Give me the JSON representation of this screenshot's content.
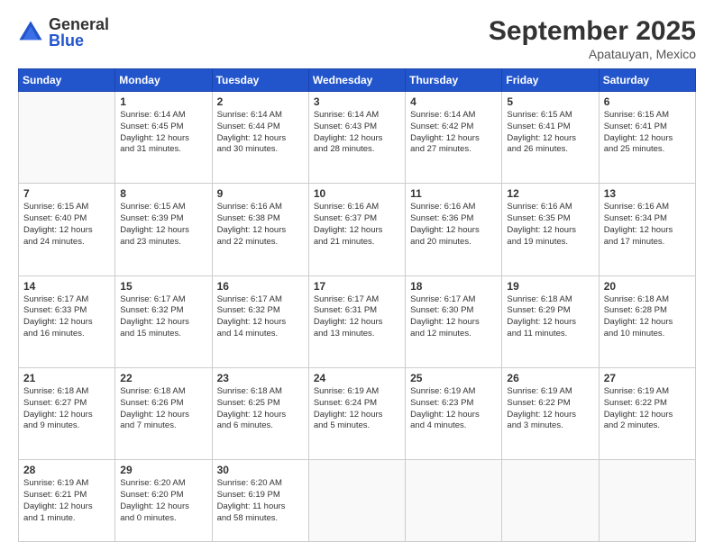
{
  "logo": {
    "general": "General",
    "blue": "Blue"
  },
  "title": "September 2025",
  "location": "Apatauyan, Mexico",
  "days": [
    "Sunday",
    "Monday",
    "Tuesday",
    "Wednesday",
    "Thursday",
    "Friday",
    "Saturday"
  ],
  "weeks": [
    [
      {
        "day": "",
        "info": ""
      },
      {
        "day": "1",
        "info": "Sunrise: 6:14 AM\nSunset: 6:45 PM\nDaylight: 12 hours\nand 31 minutes."
      },
      {
        "day": "2",
        "info": "Sunrise: 6:14 AM\nSunset: 6:44 PM\nDaylight: 12 hours\nand 30 minutes."
      },
      {
        "day": "3",
        "info": "Sunrise: 6:14 AM\nSunset: 6:43 PM\nDaylight: 12 hours\nand 28 minutes."
      },
      {
        "day": "4",
        "info": "Sunrise: 6:14 AM\nSunset: 6:42 PM\nDaylight: 12 hours\nand 27 minutes."
      },
      {
        "day": "5",
        "info": "Sunrise: 6:15 AM\nSunset: 6:41 PM\nDaylight: 12 hours\nand 26 minutes."
      },
      {
        "day": "6",
        "info": "Sunrise: 6:15 AM\nSunset: 6:41 PM\nDaylight: 12 hours\nand 25 minutes."
      }
    ],
    [
      {
        "day": "7",
        "info": "Sunrise: 6:15 AM\nSunset: 6:40 PM\nDaylight: 12 hours\nand 24 minutes."
      },
      {
        "day": "8",
        "info": "Sunrise: 6:15 AM\nSunset: 6:39 PM\nDaylight: 12 hours\nand 23 minutes."
      },
      {
        "day": "9",
        "info": "Sunrise: 6:16 AM\nSunset: 6:38 PM\nDaylight: 12 hours\nand 22 minutes."
      },
      {
        "day": "10",
        "info": "Sunrise: 6:16 AM\nSunset: 6:37 PM\nDaylight: 12 hours\nand 21 minutes."
      },
      {
        "day": "11",
        "info": "Sunrise: 6:16 AM\nSunset: 6:36 PM\nDaylight: 12 hours\nand 20 minutes."
      },
      {
        "day": "12",
        "info": "Sunrise: 6:16 AM\nSunset: 6:35 PM\nDaylight: 12 hours\nand 19 minutes."
      },
      {
        "day": "13",
        "info": "Sunrise: 6:16 AM\nSunset: 6:34 PM\nDaylight: 12 hours\nand 17 minutes."
      }
    ],
    [
      {
        "day": "14",
        "info": "Sunrise: 6:17 AM\nSunset: 6:33 PM\nDaylight: 12 hours\nand 16 minutes."
      },
      {
        "day": "15",
        "info": "Sunrise: 6:17 AM\nSunset: 6:32 PM\nDaylight: 12 hours\nand 15 minutes."
      },
      {
        "day": "16",
        "info": "Sunrise: 6:17 AM\nSunset: 6:32 PM\nDaylight: 12 hours\nand 14 minutes."
      },
      {
        "day": "17",
        "info": "Sunrise: 6:17 AM\nSunset: 6:31 PM\nDaylight: 12 hours\nand 13 minutes."
      },
      {
        "day": "18",
        "info": "Sunrise: 6:17 AM\nSunset: 6:30 PM\nDaylight: 12 hours\nand 12 minutes."
      },
      {
        "day": "19",
        "info": "Sunrise: 6:18 AM\nSunset: 6:29 PM\nDaylight: 12 hours\nand 11 minutes."
      },
      {
        "day": "20",
        "info": "Sunrise: 6:18 AM\nSunset: 6:28 PM\nDaylight: 12 hours\nand 10 minutes."
      }
    ],
    [
      {
        "day": "21",
        "info": "Sunrise: 6:18 AM\nSunset: 6:27 PM\nDaylight: 12 hours\nand 9 minutes."
      },
      {
        "day": "22",
        "info": "Sunrise: 6:18 AM\nSunset: 6:26 PM\nDaylight: 12 hours\nand 7 minutes."
      },
      {
        "day": "23",
        "info": "Sunrise: 6:18 AM\nSunset: 6:25 PM\nDaylight: 12 hours\nand 6 minutes."
      },
      {
        "day": "24",
        "info": "Sunrise: 6:19 AM\nSunset: 6:24 PM\nDaylight: 12 hours\nand 5 minutes."
      },
      {
        "day": "25",
        "info": "Sunrise: 6:19 AM\nSunset: 6:23 PM\nDaylight: 12 hours\nand 4 minutes."
      },
      {
        "day": "26",
        "info": "Sunrise: 6:19 AM\nSunset: 6:22 PM\nDaylight: 12 hours\nand 3 minutes."
      },
      {
        "day": "27",
        "info": "Sunrise: 6:19 AM\nSunset: 6:22 PM\nDaylight: 12 hours\nand 2 minutes."
      }
    ],
    [
      {
        "day": "28",
        "info": "Sunrise: 6:19 AM\nSunset: 6:21 PM\nDaylight: 12 hours\nand 1 minute."
      },
      {
        "day": "29",
        "info": "Sunrise: 6:20 AM\nSunset: 6:20 PM\nDaylight: 12 hours\nand 0 minutes."
      },
      {
        "day": "30",
        "info": "Sunrise: 6:20 AM\nSunset: 6:19 PM\nDaylight: 11 hours\nand 58 minutes."
      },
      {
        "day": "",
        "info": ""
      },
      {
        "day": "",
        "info": ""
      },
      {
        "day": "",
        "info": ""
      },
      {
        "day": "",
        "info": ""
      }
    ]
  ]
}
